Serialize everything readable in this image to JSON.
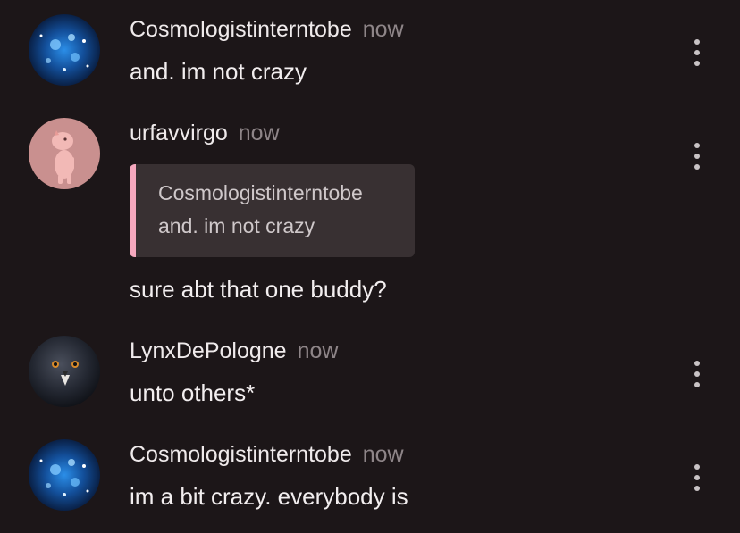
{
  "messages": [
    {
      "username": "Cosmologistinterntobe",
      "time": "now",
      "text": "and. im not crazy",
      "avatar_icon": "galaxy-avatar"
    },
    {
      "username": "urfavvirgo",
      "time": "now",
      "reply_to": {
        "username": "Cosmologistinterntobe",
        "text": "and. im not crazy"
      },
      "text": "sure abt that one buddy?",
      "avatar_icon": "pink-dinosaur-avatar"
    },
    {
      "username": "LynxDePologne",
      "time": "now",
      "text": "unto others*",
      "avatar_icon": "pigeon-avatar"
    },
    {
      "username": "Cosmologistinterntobe",
      "time": "now",
      "text": "im a bit crazy. everybody is",
      "avatar_icon": "galaxy-avatar"
    }
  ],
  "colors": {
    "background": "#1c1618",
    "quote_accent": "#f5a8be",
    "quote_background": "#383032",
    "timestamp": "#8e8588"
  },
  "icons": {
    "more": "more-vertical-icon"
  }
}
